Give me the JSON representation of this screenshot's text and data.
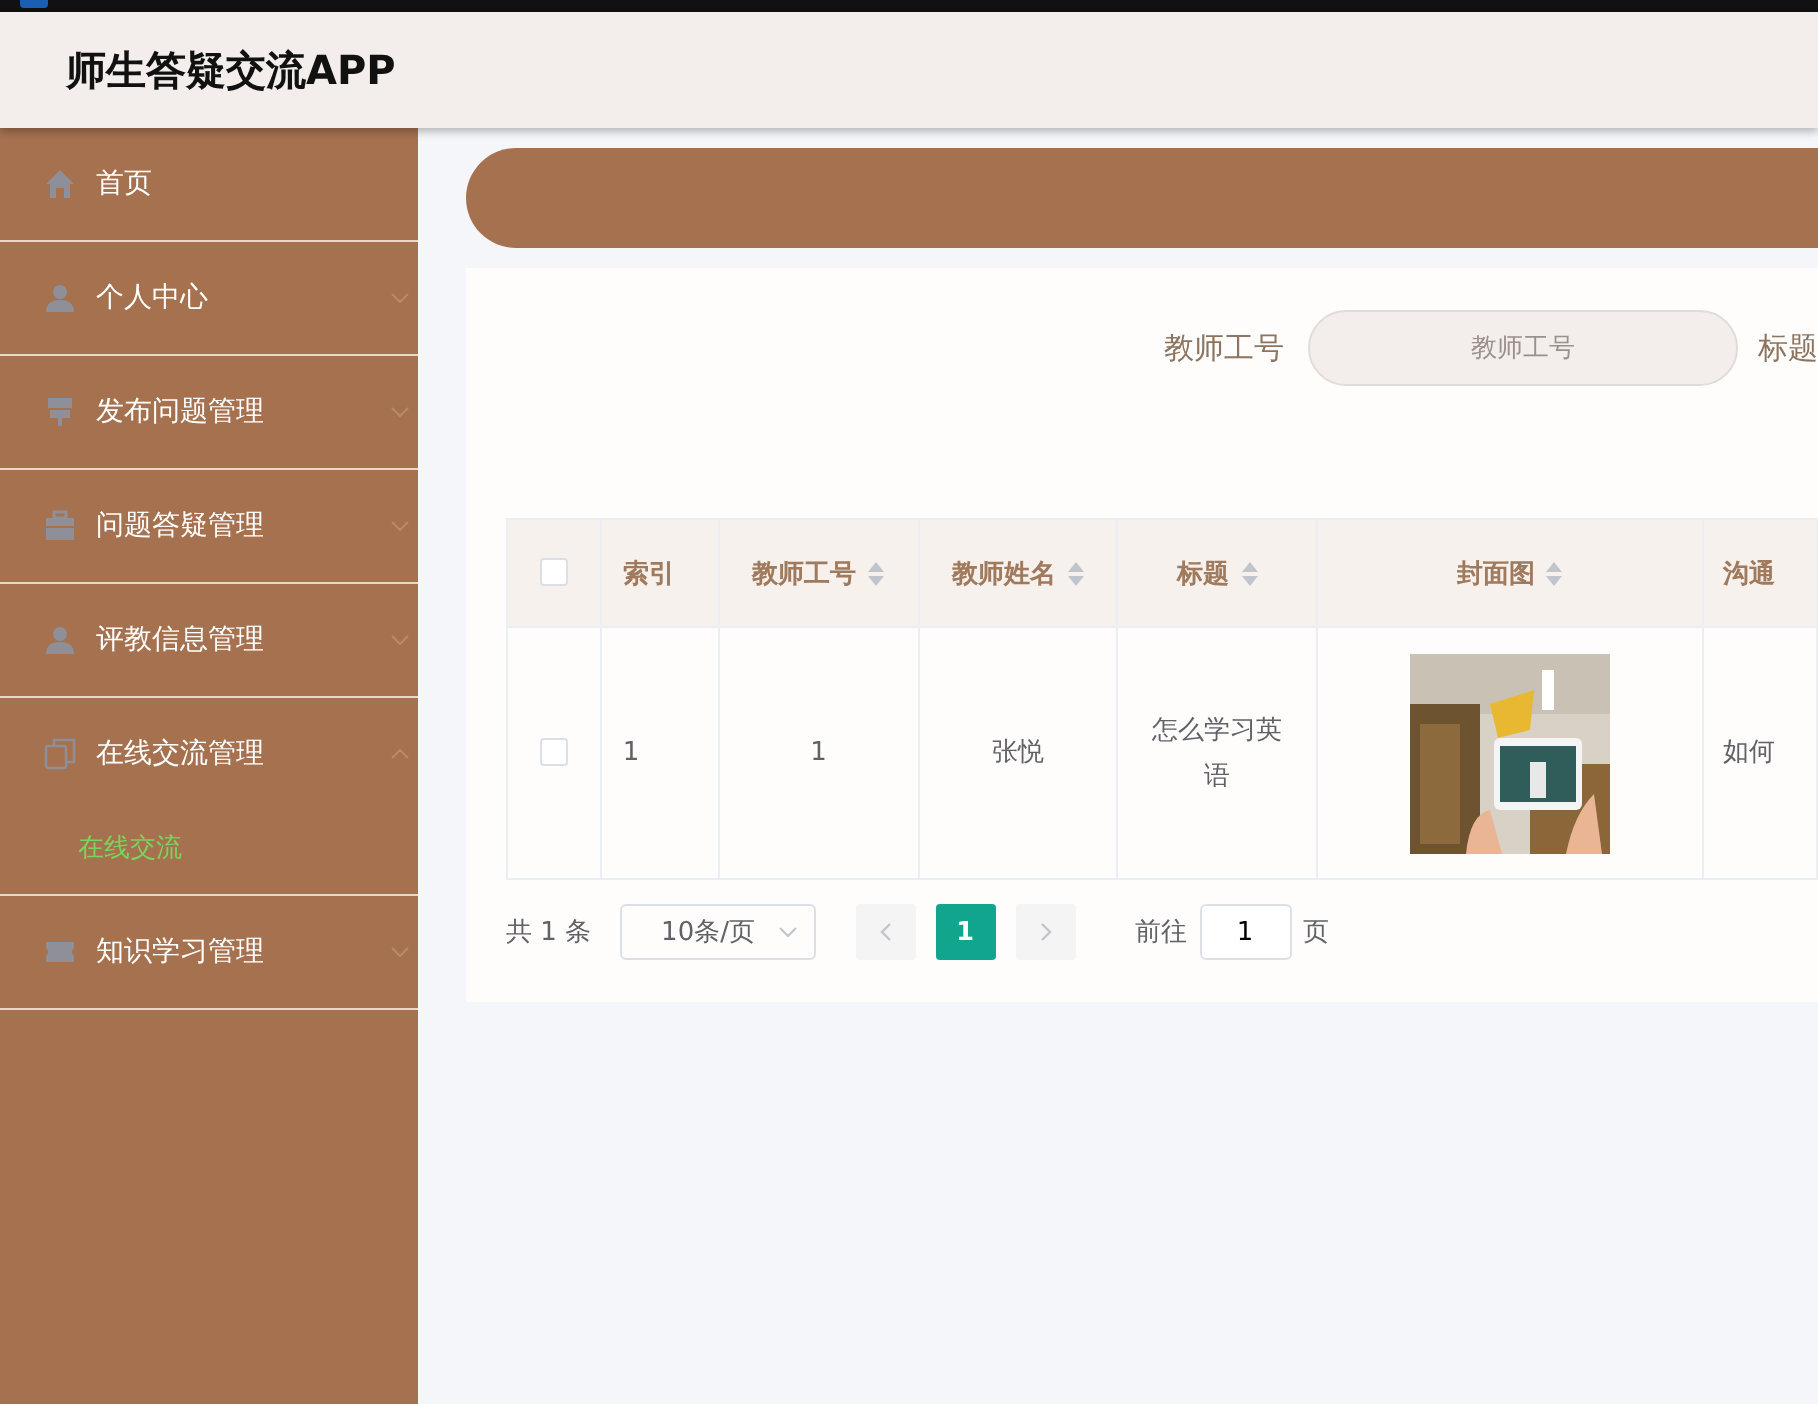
{
  "app": {
    "title": "师生答疑交流APP"
  },
  "sidebar": {
    "items": [
      {
        "label": "首页"
      },
      {
        "label": "个人中心",
        "expanded": false
      },
      {
        "label": "发布问题管理",
        "expanded": false
      },
      {
        "label": "问题答疑管理",
        "expanded": false
      },
      {
        "label": "评教信息管理",
        "expanded": false
      },
      {
        "label": "在线交流管理",
        "expanded": true,
        "children": [
          {
            "label": "在线交流",
            "selected": true
          }
        ]
      },
      {
        "label": "知识学习管理",
        "expanded": false
      }
    ]
  },
  "search": {
    "fields": [
      {
        "label": "教师工号",
        "placeholder": "教师工号"
      }
    ],
    "next_label": "标题"
  },
  "table": {
    "all_checked": false,
    "columns": [
      {
        "label": "索引",
        "sortable": false
      },
      {
        "label": "教师工号",
        "sortable": true
      },
      {
        "label": "教师姓名",
        "sortable": true
      },
      {
        "label": "标题",
        "sortable": true
      },
      {
        "label": "封面图",
        "sortable": true
      },
      {
        "label": "沟通",
        "sortable": false
      }
    ],
    "rows": [
      {
        "checked": false,
        "cells": [
          "1",
          "1",
          "张悦",
          "怎么学习英语",
          {
            "kind": "picture"
          },
          "如何"
        ]
      }
    ]
  },
  "pagination": {
    "total": "共 1 条",
    "page_size": "10条/页",
    "pages": [
      {
        "label": "1",
        "selected": true
      }
    ],
    "goto_label": "前往",
    "goto_value": "1",
    "page_unit": "页"
  }
}
